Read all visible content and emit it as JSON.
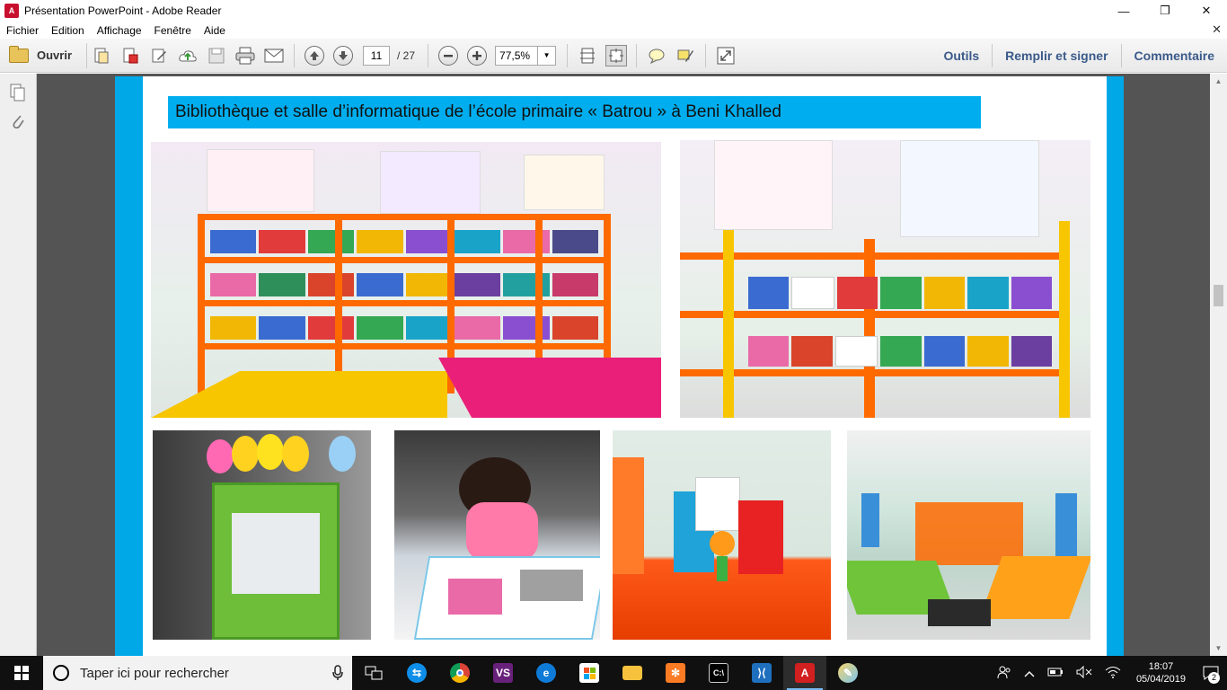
{
  "window": {
    "title": "Présentation PowerPoint - Adobe Reader",
    "app_icon": "pdf-icon",
    "minimize": "—",
    "restore": "❐",
    "close": "✕"
  },
  "menu": {
    "items": [
      "Fichier",
      "Edition",
      "Affichage",
      "Fenêtre",
      "Aide"
    ],
    "close_doc": "✕"
  },
  "toolbar": {
    "open_label": "Ouvrir",
    "page_current": "11",
    "page_total": "/ 27",
    "zoom": "77,5%",
    "tools_label": "Outils",
    "fill_sign_label": "Remplir et signer",
    "comment_label": "Commentaire"
  },
  "document": {
    "heading": "Bibliothèque et salle d’informatique de l’école primaire  « Batrou »  à Beni Khalled",
    "accent_color": "#00aeef"
  },
  "taskbar": {
    "search_placeholder": "Taper ici pour rechercher",
    "time": "18:07",
    "date": "05/04/2019",
    "notification_count": "2",
    "apps": [
      "task-view-icon",
      "teamviewer-icon",
      "chrome-icon",
      "visual-studio-icon",
      "edge-icon",
      "store-icon",
      "file-explorer-icon",
      "xampp-icon",
      "terminal-icon",
      "vscode-icon",
      "adobe-reader-icon",
      "paint-icon"
    ]
  }
}
